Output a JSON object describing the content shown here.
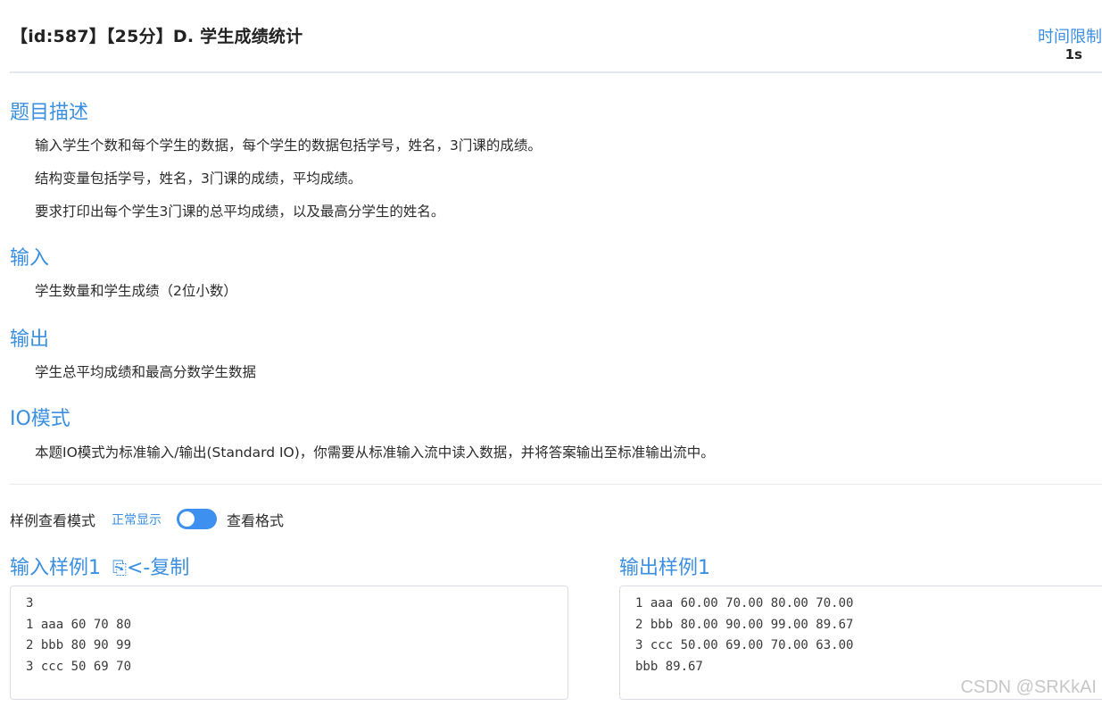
{
  "header": {
    "title": "【id:587】【25分】D. 学生成绩统计",
    "time_limit_label": "时间限制",
    "time_limit_value": "1s"
  },
  "sections": [
    {
      "title": "题目描述",
      "paragraphs": [
        "输入学生个数和每个学生的数据，每个学生的数据包括学号，姓名，3门课的成绩。",
        "结构变量包括学号，姓名，3门课的成绩，平均成绩。",
        "要求打印出每个学生3门课的总平均成绩，以及最高分学生的姓名。"
      ]
    },
    {
      "title": "输入",
      "paragraphs": [
        "学生数量和学生成绩（2位小数）"
      ]
    },
    {
      "title": "输出",
      "paragraphs": [
        "学生总平均成绩和最高分数学生数据"
      ]
    },
    {
      "title": "IO模式",
      "paragraphs": [
        "本题IO模式为标准输入/输出(Standard IO)，你需要从标准输入流中读入数据，并将答案输出至标准输出流中。"
      ]
    }
  ],
  "sample_mode": {
    "label": "样例查看模式",
    "normal_label": "正常显示",
    "format_label": "查看格式",
    "toggle_on": true
  },
  "samples": {
    "input_title": "输入样例1",
    "copy_label": "<-复制",
    "input_lines": [
      "3",
      "1 aaa 60 70 80",
      "2 bbb 80 90 99",
      "3 ccc 50 69 70"
    ],
    "output_title": "输出样例1",
    "output_lines": [
      "1 aaa 60.00 70.00 80.00 70.00",
      "2 bbb 80.00 90.00 99.00 89.67",
      "3 ccc 50.00 69.00 70.00 63.00",
      "bbb 89.67"
    ]
  },
  "watermark": "CSDN @SRKkAI",
  "colors": {
    "accent": "#3b8fe0",
    "toggle": "#3d8ff0",
    "text": "#2b2b2b"
  }
}
